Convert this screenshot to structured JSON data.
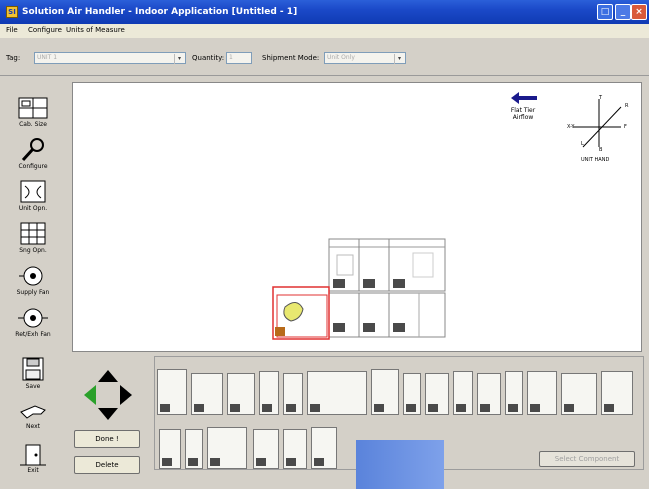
{
  "window": {
    "title": "Solution Air Handler - Indoor Application [Untitled - 1]",
    "icon_name": "app-icon"
  },
  "menu": [
    "File",
    "Configure",
    "Units of Measure"
  ],
  "toolbar": {
    "tag_label": "Tag:",
    "tag_value": "UNIT 1",
    "quantity_label": "Quantity:",
    "quantity_value": "1",
    "shipment_label": "Shipment Mode:",
    "shipment_value": "Unit Only"
  },
  "tools": [
    {
      "label": "Cab. Size",
      "icon": "cabinet-size-icon"
    },
    {
      "label": "Configure",
      "icon": "configure-wrench-icon"
    },
    {
      "label": "Unit Opn.",
      "icon": "unit-opening-icon"
    },
    {
      "label": "Sng Opn.",
      "icon": "single-opening-icon"
    },
    {
      "label": "Supply Fan",
      "icon": "supply-fan-icon"
    },
    {
      "label": "Ret/Exh Fan",
      "icon": "return-exhaust-fan-icon"
    },
    {
      "label": "Save",
      "icon": "save-disk-icon"
    },
    {
      "label": "Next",
      "icon": "next-hand-icon"
    },
    {
      "label": "Exit",
      "icon": "exit-door-icon"
    }
  ],
  "canvas": {
    "airflow_label_line1": "Flat Tier",
    "airflow_label_line2": "Airflow",
    "axis": {
      "x_neg": "X-Y",
      "x_pos": "F",
      "y_pos": "T",
      "y_neg": "B",
      "z_pos": "R",
      "z_neg": "L",
      "caption": "UNIT HAND"
    }
  },
  "bottom": {
    "done_label": "Done !",
    "delete_label": "Delete",
    "disabled_button_label": "Select Component"
  },
  "colors": {
    "titlebar": "#1b49c8",
    "selected_outline": "#e03030",
    "fan_highlight": "#e8e870"
  }
}
